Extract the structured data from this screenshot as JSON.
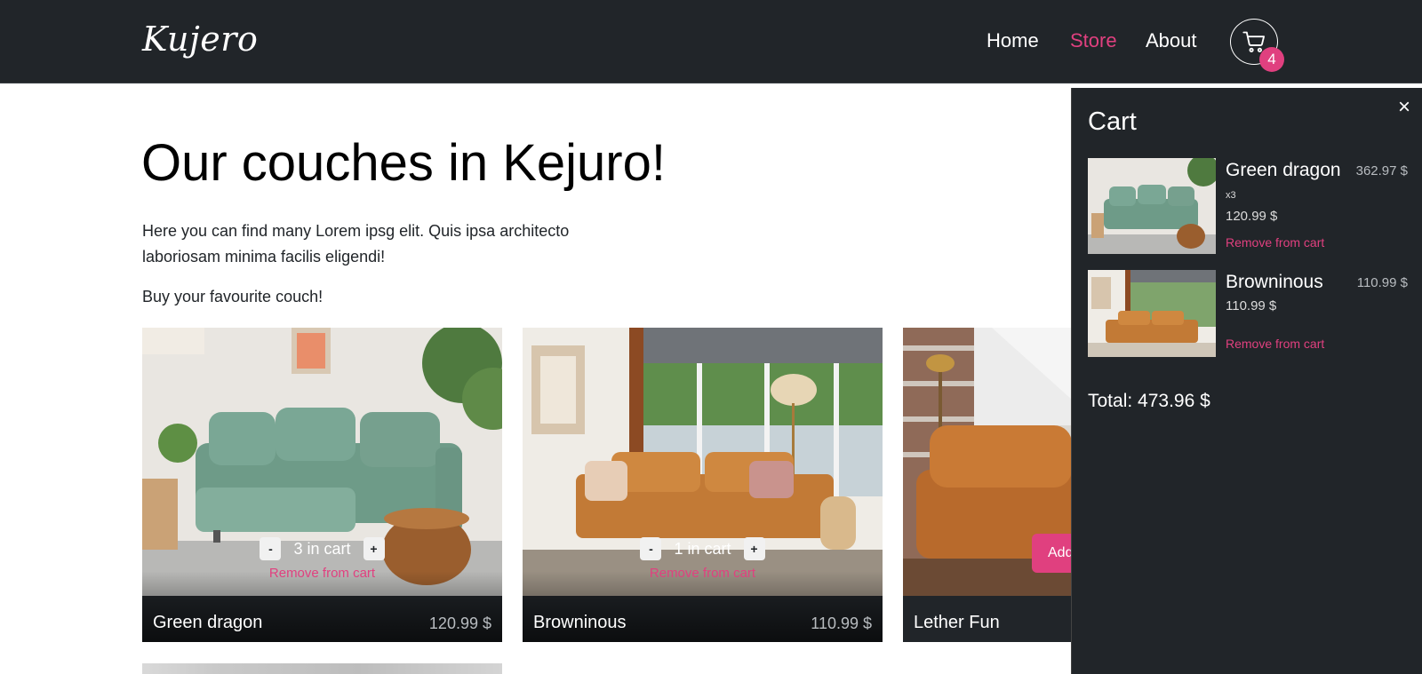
{
  "colors": {
    "accent": "#e0407f",
    "navbar": "#212529",
    "panel": "#212529"
  },
  "navbar": {
    "brand": "Kujero",
    "links": [
      {
        "label": "Home",
        "active": false
      },
      {
        "label": "Store",
        "active": true
      },
      {
        "label": "About",
        "active": false
      }
    ],
    "cart_icon": "cart-icon",
    "cart_count": "4"
  },
  "hero": {
    "title": "Our couches in Kejuro!",
    "text": "Here you can find many Lorem ipsg elit. Quis ipsa architecto laboriosam minima facilis eligendi!",
    "cta": "Buy your favourite couch!"
  },
  "products": [
    {
      "name": "Green dragon",
      "price": "120.99 $",
      "qty_label": "3 in cart",
      "minus": "-",
      "plus": "+",
      "remove": "Remove from cart",
      "image": "green-sofa"
    },
    {
      "name": "Browninous",
      "price": "110.99 $",
      "qty_label": "1 in cart",
      "minus": "-",
      "plus": "+",
      "remove": "Remove from cart",
      "image": "brown-sofa"
    },
    {
      "name": "Lether Fun",
      "add_label": "Add",
      "image": "leather-sofa"
    }
  ],
  "cart": {
    "title": "Cart",
    "close": "×",
    "items": [
      {
        "name": "Green dragon",
        "total": "362.97 $",
        "qty": "x3",
        "price": "120.99 $",
        "remove": "Remove from cart"
      },
      {
        "name": "Browninous",
        "total": "110.99 $",
        "price": "110.99 $",
        "remove": "Remove from cart"
      }
    ],
    "total": "Total: 473.96 $"
  }
}
